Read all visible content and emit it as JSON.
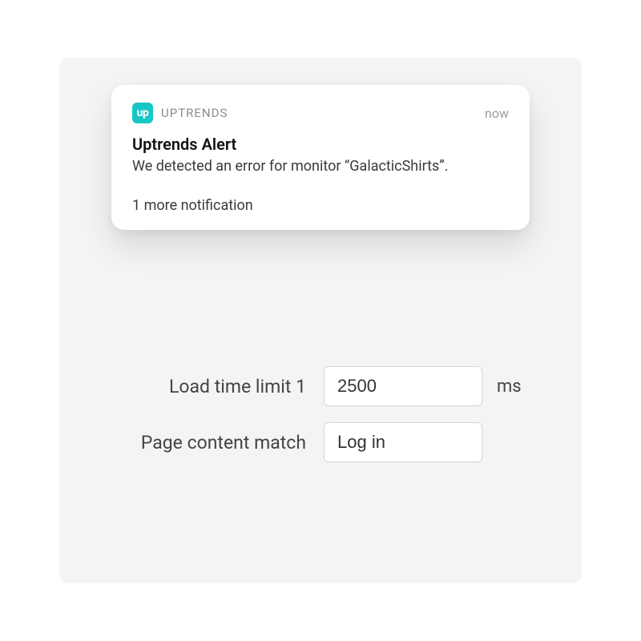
{
  "notification": {
    "app_icon_text": "up",
    "app_name": "UPTRENDS",
    "timestamp": "now",
    "title": "Uptrends Alert",
    "body": "We detected an error for monitor “GalacticShirts”.",
    "more": "1 more notification"
  },
  "form": {
    "load_time": {
      "label": "Load time limit 1",
      "value": "2500",
      "unit": "ms"
    },
    "content_match": {
      "label": "Page content match",
      "value": "Log in"
    }
  }
}
